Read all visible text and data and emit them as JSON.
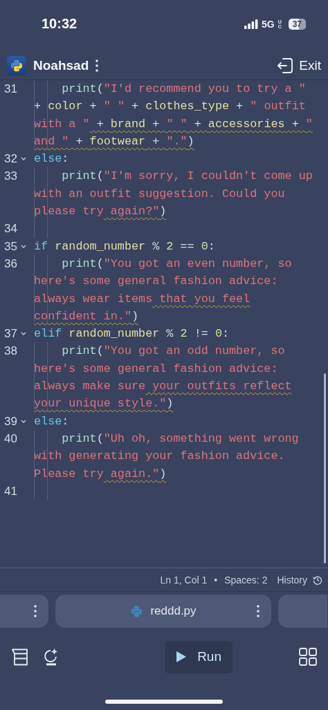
{
  "phone_status": {
    "time": "10:32",
    "network": "5G",
    "network_badge": "UC",
    "battery": "37"
  },
  "header": {
    "title": "Noahsad",
    "exit_label": "Exit"
  },
  "editor": {
    "lines": [
      {
        "number": "31",
        "fold": false,
        "indented": true,
        "rows": [
          {
            "segments": [
              {
                "kind": "func",
                "text": "print"
              },
              {
                "kind": "punct",
                "text": "("
              },
              {
                "kind": "string",
                "text": "\"I'd recommend you to try a \""
              }
            ]
          },
          {
            "segments": [
              {
                "kind": "punct",
                "text": "+ "
              },
              {
                "kind": "var",
                "text": "color"
              },
              {
                "kind": "punct",
                "text": " + "
              },
              {
                "kind": "string",
                "text": "\" \""
              },
              {
                "kind": "punct",
                "text": " + "
              },
              {
                "kind": "var",
                "text": "clothes_type"
              },
              {
                "kind": "punct",
                "text": " + "
              },
              {
                "kind": "string",
                "text": "\" outfit"
              }
            ]
          },
          {
            "segments": [
              {
                "kind": "string",
                "text": "with a \""
              },
              {
                "kind": "punct",
                "text": " + ",
                "warn": true
              },
              {
                "kind": "var",
                "text": "brand",
                "warn": true
              },
              {
                "kind": "punct",
                "text": " + ",
                "warn": true
              },
              {
                "kind": "string",
                "text": "\" \"",
                "warn": true
              },
              {
                "kind": "punct",
                "text": " + ",
                "warn": true
              },
              {
                "kind": "var",
                "text": "accessories",
                "warn": true
              },
              {
                "kind": "punct",
                "text": " + ",
                "warn": true
              },
              {
                "kind": "string",
                "text": "\"",
                "warn": true
              }
            ]
          },
          {
            "segments": [
              {
                "kind": "string",
                "text": "and \"",
                "warn": true
              },
              {
                "kind": "punct",
                "text": " + ",
                "warn": true
              },
              {
                "kind": "var",
                "text": "footwear",
                "warn": true
              },
              {
                "kind": "punct",
                "text": " + ",
                "warn": true
              },
              {
                "kind": "string",
                "text": "\".\"",
                "warn": true
              },
              {
                "kind": "punct",
                "text": ")",
                "warn": true
              }
            ]
          }
        ]
      },
      {
        "number": "32",
        "fold": true,
        "indented": false,
        "rows": [
          {
            "segments": [
              {
                "kind": "keyword",
                "text": "else"
              },
              {
                "kind": "punct",
                "text": ":"
              }
            ]
          }
        ]
      },
      {
        "number": "33",
        "fold": false,
        "indented": true,
        "rows": [
          {
            "segments": [
              {
                "kind": "func",
                "text": "print"
              },
              {
                "kind": "punct",
                "text": "("
              },
              {
                "kind": "string",
                "text": "\"I'm sorry, I couldn't come up"
              }
            ]
          },
          {
            "segments": [
              {
                "kind": "string",
                "text": "with an outfit suggestion. Could you"
              }
            ]
          },
          {
            "segments": [
              {
                "kind": "string",
                "text": "please try"
              },
              {
                "kind": "string",
                "text": " again?\"",
                "warn": true
              },
              {
                "kind": "punct",
                "text": ")",
                "warn": true
              }
            ]
          }
        ]
      },
      {
        "number": "34",
        "fold": false,
        "indented": true,
        "rows": [
          {}
        ]
      },
      {
        "number": "35",
        "fold": true,
        "indented": false,
        "rows": [
          {
            "segments": [
              {
                "kind": "keyword",
                "text": "if "
              },
              {
                "kind": "var",
                "text": "random_number"
              },
              {
                "kind": "punct",
                "text": " % "
              },
              {
                "kind": "number",
                "text": "2"
              },
              {
                "kind": "punct",
                "text": " == "
              },
              {
                "kind": "number",
                "text": "0"
              },
              {
                "kind": "punct",
                "text": ":"
              }
            ]
          }
        ]
      },
      {
        "number": "36",
        "fold": false,
        "indented": true,
        "rows": [
          {
            "segments": [
              {
                "kind": "func",
                "text": "print"
              },
              {
                "kind": "punct",
                "text": "("
              },
              {
                "kind": "string",
                "text": "\"You got an even number, so"
              }
            ]
          },
          {
            "segments": [
              {
                "kind": "string",
                "text": "here's some general fashion advice:"
              }
            ]
          },
          {
            "segments": [
              {
                "kind": "string",
                "text": "always wear items"
              },
              {
                "kind": "string",
                "text": " that you feel",
                "warn": true
              }
            ]
          },
          {
            "segments": [
              {
                "kind": "string",
                "text": "confident in.\"",
                "warn": true
              },
              {
                "kind": "punct",
                "text": ")",
                "warn": true
              }
            ]
          }
        ]
      },
      {
        "number": "37",
        "fold": true,
        "indented": false,
        "rows": [
          {
            "segments": [
              {
                "kind": "keyword",
                "text": "elif "
              },
              {
                "kind": "var",
                "text": "random_number"
              },
              {
                "kind": "punct",
                "text": " % "
              },
              {
                "kind": "number",
                "text": "2"
              },
              {
                "kind": "punct",
                "text": " != "
              },
              {
                "kind": "number",
                "text": "0"
              },
              {
                "kind": "punct",
                "text": ":"
              }
            ]
          }
        ]
      },
      {
        "number": "38",
        "fold": false,
        "indented": true,
        "rows": [
          {
            "segments": [
              {
                "kind": "func",
                "text": "print"
              },
              {
                "kind": "punct",
                "text": "("
              },
              {
                "kind": "string",
                "text": "\"You got an odd number, so"
              }
            ]
          },
          {
            "segments": [
              {
                "kind": "string",
                "text": "here's some general fashion advice:"
              }
            ]
          },
          {
            "segments": [
              {
                "kind": "string",
                "text": "always make sure"
              },
              {
                "kind": "string",
                "text": " your outfits reflect",
                "warn": true
              }
            ]
          },
          {
            "segments": [
              {
                "kind": "string",
                "text": "your unique style.\"",
                "warn": true
              },
              {
                "kind": "punct",
                "text": ")",
                "warn": true
              }
            ]
          }
        ]
      },
      {
        "number": "39",
        "fold": true,
        "indented": false,
        "rows": [
          {
            "segments": [
              {
                "kind": "keyword",
                "text": "else"
              },
              {
                "kind": "punct",
                "text": ":"
              }
            ]
          }
        ]
      },
      {
        "number": "40",
        "fold": false,
        "indented": true,
        "rows": [
          {
            "segments": [
              {
                "kind": "func",
                "text": "print"
              },
              {
                "kind": "punct",
                "text": "("
              },
              {
                "kind": "string",
                "text": "\"Uh oh, something went wrong"
              }
            ]
          },
          {
            "segments": [
              {
                "kind": "string",
                "text": "with generating your fashion advice."
              }
            ]
          },
          {
            "segments": [
              {
                "kind": "string",
                "text": "Please try"
              },
              {
                "kind": "string",
                "text": " again.\"",
                "warn": true
              },
              {
                "kind": "punct",
                "text": ")",
                "warn": true
              }
            ]
          }
        ]
      },
      {
        "number": "41",
        "fold": false,
        "indented": true,
        "rows": [
          {}
        ]
      }
    ]
  },
  "status_bar": {
    "position": "Ln 1, Col 1",
    "separator": "•",
    "spaces": "Spaces: 2",
    "history": "History"
  },
  "file_tabs": [
    {
      "kind": "partial-left"
    },
    {
      "kind": "file",
      "name": "reddd.py"
    },
    {
      "kind": "partial-right"
    }
  ],
  "toolbar": {
    "run_label": "Run"
  }
}
